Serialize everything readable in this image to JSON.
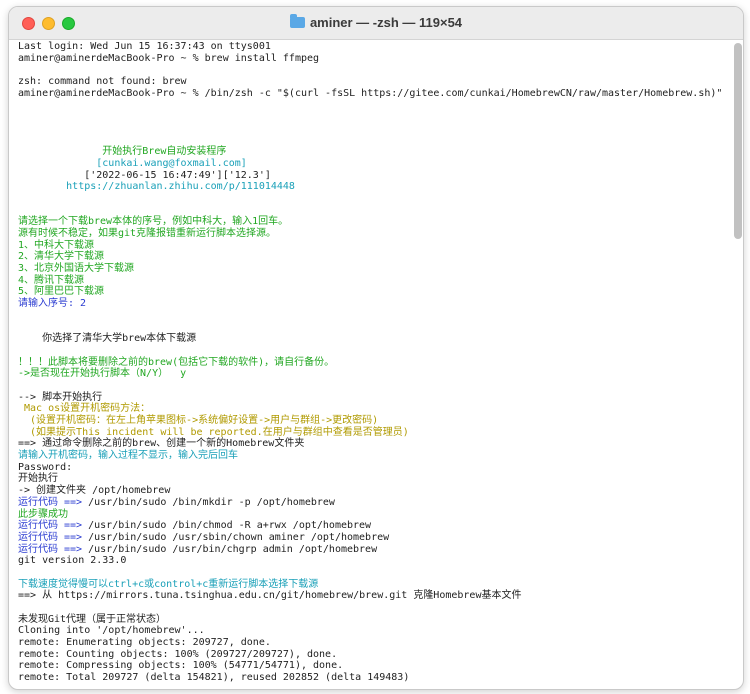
{
  "window": {
    "title": "aminer — -zsh — 119×54",
    "folder_icon": "folder-icon"
  },
  "lines": [
    {
      "t": "Last login: Wed Jun 15 16:37:43 on ttys001",
      "cls": ""
    },
    {
      "t": "aminer@aminerdeMacBook-Pro ~ % brew install ffmpeg",
      "cls": ""
    },
    {
      "t": "",
      "cls": ""
    },
    {
      "t": "zsh: command not found: brew",
      "cls": ""
    },
    {
      "t": "aminer@aminerdeMacBook-Pro ~ % /bin/zsh -c \"$(curl -fsSL https://gitee.com/cunkai/HomebrewCN/raw/master/Homebrew.sh)\"",
      "cls": ""
    },
    {
      "t": "",
      "cls": ""
    },
    {
      "t": "",
      "cls": ""
    },
    {
      "t": "",
      "cls": ""
    },
    {
      "t": "",
      "cls": ""
    },
    {
      "t": "              开始执行Brew自动安装程序",
      "cls": "g"
    },
    {
      "t": "             [cunkai.wang@foxmail.com]",
      "cls": "c"
    },
    {
      "t": "           ['2022-06-15 16:47:49']['12.3']",
      "cls": ""
    },
    {
      "t": "        https://zhuanlan.zhihu.com/p/111014448",
      "cls": "c"
    },
    {
      "t": "",
      "cls": ""
    },
    {
      "t": "",
      "cls": ""
    },
    {
      "t": "请选择一个下载brew本体的序号，例如中科大，输入1回车。",
      "cls": "g"
    },
    {
      "t": "源有时候不稳定，如果git克隆报错重新运行脚本选择源。",
      "cls": "g"
    },
    {
      "t": "1、中科大下载源",
      "cls": "g"
    },
    {
      "t": "2、清华大学下载源",
      "cls": "g"
    },
    {
      "t": "3、北京外国语大学下载源",
      "cls": "g"
    },
    {
      "t": "4、腾讯下载源",
      "cls": "g"
    },
    {
      "t": "5、阿里巴巴下载源",
      "cls": "g"
    },
    {
      "t": "请输入序号: 2",
      "cls": "b"
    },
    {
      "t": "",
      "cls": ""
    },
    {
      "t": "",
      "cls": ""
    },
    {
      "t": "    你选择了清华大学brew本体下载源",
      "cls": ""
    },
    {
      "t": "",
      "cls": ""
    },
    {
      "t": "！！！此脚本将要删除之前的brew(包括它下载的软件)，请自行备份。",
      "cls": "g"
    },
    {
      "t": "->是否现在开始执行脚本（N/Y）  y",
      "cls": "g"
    },
    {
      "t": "",
      "cls": ""
    },
    {
      "t": "--> 脚本开始执行",
      "cls": ""
    },
    {
      "t": " Mac os设置开机密码方法：",
      "cls": "y"
    },
    {
      "t": "  (设置开机密码：在左上角苹果图标->系统偏好设置->用户与群组->更改密码)",
      "cls": "y"
    },
    {
      "t": "  (如果提示This incident will be reported.在用户与群组中查看是否管理员)",
      "cls": "y"
    },
    {
      "t": "==> 通过命令删除之前的brew、创建一个新的Homebrew文件夹",
      "cls": ""
    },
    {
      "t": "请输入开机密码，输入过程不显示，输入完后回车",
      "cls": "c"
    },
    {
      "t": "Password:",
      "cls": ""
    },
    {
      "t": "开始执行",
      "cls": ""
    },
    {
      "t": "-> 创建文件夹 /opt/homebrew",
      "cls": ""
    },
    {
      "t": "运行代码 ==> /usr/bin/sudo /bin/mkdir -p /opt/homebrew",
      "cls": "mix"
    },
    {
      "t": "此步骤成功",
      "cls": "g"
    },
    {
      "t": "运行代码 ==> /usr/bin/sudo /bin/chmod -R a+rwx /opt/homebrew",
      "cls": "mix"
    },
    {
      "t": "运行代码 ==> /usr/bin/sudo /usr/sbin/chown aminer /opt/homebrew",
      "cls": "mix"
    },
    {
      "t": "运行代码 ==> /usr/bin/sudo /usr/bin/chgrp admin /opt/homebrew",
      "cls": "mix"
    },
    {
      "t": "git version 2.33.0",
      "cls": ""
    },
    {
      "t": "",
      "cls": ""
    },
    {
      "t": "下载速度觉得慢可以ctrl+c或control+c重新运行脚本选择下载源",
      "cls": "c"
    },
    {
      "t": "==> 从 https://mirrors.tuna.tsinghua.edu.cn/git/homebrew/brew.git 克隆Homebrew基本文件",
      "cls": ""
    },
    {
      "t": "",
      "cls": ""
    },
    {
      "t": "未发现Git代理（属于正常状态）",
      "cls": ""
    },
    {
      "t": "Cloning into '/opt/homebrew'...",
      "cls": ""
    },
    {
      "t": "remote: Enumerating objects: 209727, done.",
      "cls": ""
    },
    {
      "t": "remote: Counting objects: 100% (209727/209727), done.",
      "cls": ""
    },
    {
      "t": "remote: Compressing objects: 100% (54771/54771), done.",
      "cls": ""
    },
    {
      "t": "remote: Total 209727 (delta 154821), reused 202852 (delta 149483)",
      "cls": ""
    }
  ]
}
